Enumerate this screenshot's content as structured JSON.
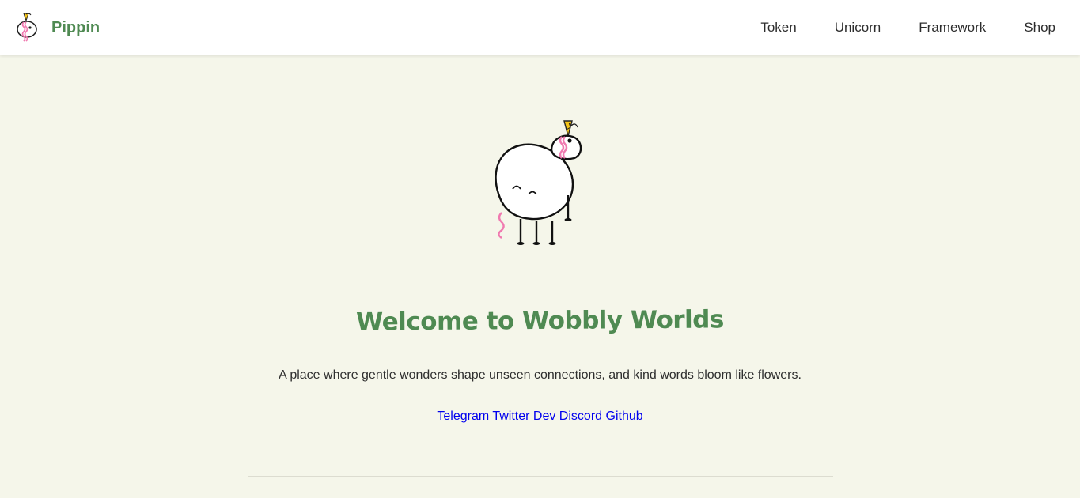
{
  "brand": {
    "name": "Pippin",
    "logo_icon": "unicorn-logo-icon",
    "color": "#4f8a52"
  },
  "nav": {
    "items": [
      {
        "label": "Token"
      },
      {
        "label": "Unicorn"
      },
      {
        "label": "Framework"
      },
      {
        "label": "Shop"
      }
    ]
  },
  "hero": {
    "mascot_icon": "unicorn-mascot-illustration",
    "title": "Welcome to Wobbly Worlds",
    "tagline": "A place where gentle wonders shape unseen connections, and kind words bloom like flowers.",
    "links": [
      {
        "label": "Telegram"
      },
      {
        "label": "Twitter"
      },
      {
        "label": "Dev Discord"
      },
      {
        "label": "Github"
      }
    ]
  },
  "colors": {
    "background": "#f5f6ea",
    "navbar": "#ffffff",
    "accent_green": "#4f8a52",
    "mane_pink": "#f07ab0",
    "horn_yellow": "#f5c518",
    "link_blue": "#0000ee"
  }
}
